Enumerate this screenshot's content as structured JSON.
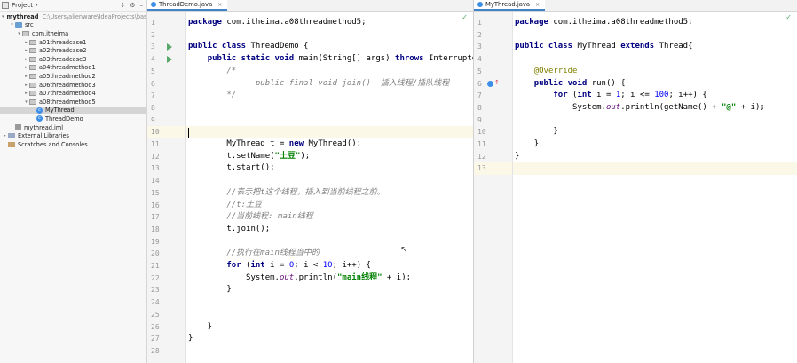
{
  "project_panel": {
    "title": "Project",
    "tree": [
      {
        "label": "mythread",
        "path": "C:\\Users\\alienware\\IdeaProjects\\basic",
        "indent": 0,
        "kind": "folder",
        "bold": true,
        "arrow": "▾"
      },
      {
        "label": "src",
        "indent": 1,
        "kind": "src",
        "arrow": "▾"
      },
      {
        "label": "com.itheima",
        "indent": 2,
        "kind": "pkg",
        "arrow": "▾"
      },
      {
        "label": "a01threadcase1",
        "indent": 3,
        "kind": "pkg",
        "arrow": "▸"
      },
      {
        "label": "a02threadcase2",
        "indent": 3,
        "kind": "pkg",
        "arrow": "▸"
      },
      {
        "label": "a03threadcase3",
        "indent": 3,
        "kind": "pkg",
        "arrow": "▸"
      },
      {
        "label": "a04threadmethod1",
        "indent": 3,
        "kind": "pkg",
        "arrow": "▸"
      },
      {
        "label": "a05threadmethod2",
        "indent": 3,
        "kind": "pkg",
        "arrow": "▸"
      },
      {
        "label": "a06threadmethod3",
        "indent": 3,
        "kind": "pkg",
        "arrow": "▸"
      },
      {
        "label": "a07threadmethod4",
        "indent": 3,
        "kind": "pkg",
        "arrow": "▸"
      },
      {
        "label": "a08threadmethod5",
        "indent": 3,
        "kind": "pkg",
        "arrow": "▾"
      },
      {
        "label": "MyThread",
        "indent": 4,
        "kind": "cls",
        "arrow": "",
        "selected": true
      },
      {
        "label": "ThreadDemo",
        "indent": 4,
        "kind": "cls",
        "arrow": ""
      },
      {
        "label": "mythread.iml",
        "indent": 1,
        "kind": "iml",
        "arrow": ""
      },
      {
        "label": "External Libraries",
        "indent": 0,
        "kind": "lib",
        "arrow": "▸"
      },
      {
        "label": "Scratches and Consoles",
        "indent": 0,
        "kind": "scr",
        "arrow": ""
      }
    ]
  },
  "left_editor": {
    "tab": "ThreadDemo.java",
    "lines": [
      {
        "n": "1",
        "html": "<span class='kw'>package</span> com.itheima.a08threadmethod5;"
      },
      {
        "n": "2",
        "html": ""
      },
      {
        "n": "3",
        "html": "<span class='kw'>public class</span> ThreadDemo {",
        "run": true
      },
      {
        "n": "4",
        "html": "    <span class='kw'>public static void</span> main(String[] args) <span class='kw'>throws</span> InterruptedE",
        "run": true
      },
      {
        "n": "5",
        "html": "        <span class='cmt'>/*</span>"
      },
      {
        "n": "6",
        "html": "<span class='cmt'>              public final void join()  插入线程/插队线程</span>"
      },
      {
        "n": "7",
        "html": "<span class='cmt'>        */</span>"
      },
      {
        "n": "8",
        "html": ""
      },
      {
        "n": "9",
        "html": ""
      },
      {
        "n": "10",
        "html": "",
        "current": true,
        "caret": true
      },
      {
        "n": "11",
        "html": "        MyThread t = <span class='kw'>new</span> MyThread();"
      },
      {
        "n": "12",
        "html": "        t.setName(<span class='str'>\"土豆\"</span>);"
      },
      {
        "n": "13",
        "html": "        t.start();"
      },
      {
        "n": "14",
        "html": ""
      },
      {
        "n": "15",
        "html": "<span class='cmt'>        //表示把t这个线程，插入到当前线程之前。</span>"
      },
      {
        "n": "16",
        "html": "<span class='cmt'>        //t:土豆</span>"
      },
      {
        "n": "17",
        "html": "<span class='cmt'>        //当前线程: main线程</span>"
      },
      {
        "n": "18",
        "html": "        t.join();"
      },
      {
        "n": "19",
        "html": ""
      },
      {
        "n": "20",
        "html": "<span class='cmt'>        //执行在main线程当中的</span>"
      },
      {
        "n": "21",
        "html": "        <span class='kw'>for</span> (<span class='kw'>int</span> i = <span class='num-lit'>0</span>; i &lt; <span class='num-lit'>10</span>; i++) {"
      },
      {
        "n": "22",
        "html": "            System.<span class='stat'>out</span>.println(<span class='str'>\"main线程\"</span> + i);"
      },
      {
        "n": "23",
        "html": "        }"
      },
      {
        "n": "24",
        "html": ""
      },
      {
        "n": "25",
        "html": ""
      },
      {
        "n": "26",
        "html": "    }"
      },
      {
        "n": "27",
        "html": "}"
      },
      {
        "n": "28",
        "html": ""
      }
    ]
  },
  "right_editor": {
    "tab": "MyThread.java",
    "lines": [
      {
        "n": "1",
        "html": "<span class='kw'>package</span> com.itheima.a08threadmethod5;"
      },
      {
        "n": "2",
        "html": ""
      },
      {
        "n": "3",
        "html": "<span class='kw'>public class</span> MyThread <span class='kw'>extends</span> Thread{"
      },
      {
        "n": "4",
        "html": ""
      },
      {
        "n": "5",
        "html": "    <span class='ann'>@Override</span>"
      },
      {
        "n": "6",
        "html": "    <span class='kw'>public void</span> run() {",
        "override": true
      },
      {
        "n": "7",
        "html": "        <span class='kw'>for</span> (<span class='kw'>int</span> i = <span class='num-lit'>1</span>; i &lt;= <span class='num-lit'>100</span>; i++) {"
      },
      {
        "n": "8",
        "html": "            System.<span class='stat'>out</span>.println(getName() + <span class='str'>\"@\"</span> + i);"
      },
      {
        "n": "9",
        "html": ""
      },
      {
        "n": "10",
        "html": "        }"
      },
      {
        "n": "11",
        "html": "    }"
      },
      {
        "n": "12",
        "html": "}"
      },
      {
        "n": "13",
        "html": "",
        "current": true
      }
    ]
  },
  "icons": {
    "check": "✓",
    "close": "×",
    "project-icon": "folder"
  }
}
